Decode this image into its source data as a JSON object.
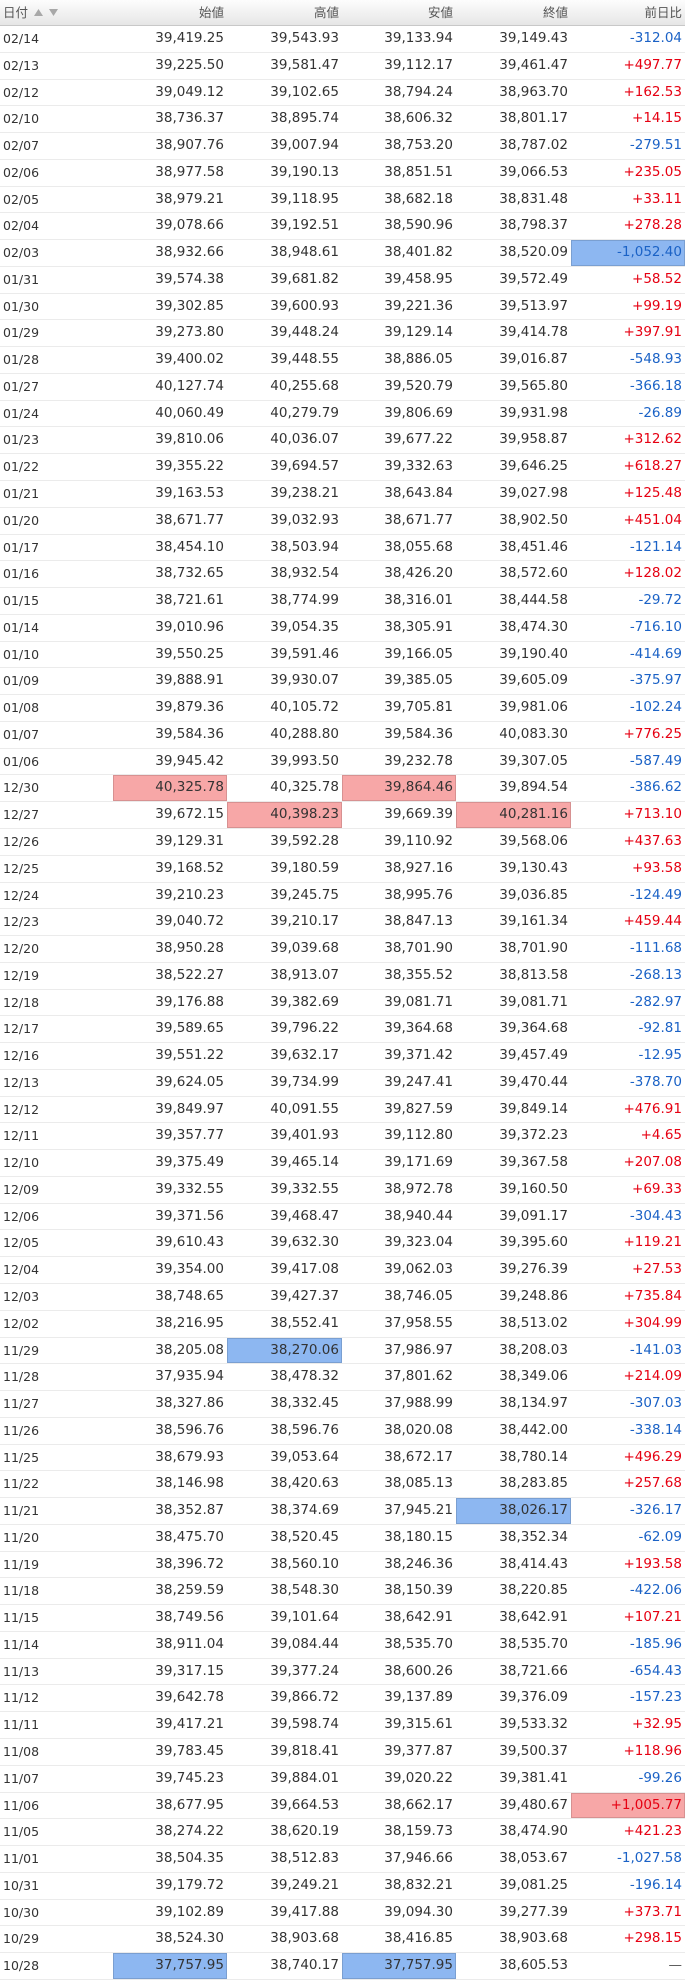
{
  "colors": {
    "up": "#e60012",
    "down": "#1b62c6",
    "flat": "#555555",
    "max_highlight": "#f7a7a7",
    "min_highlight": "#8db7f1",
    "sort_icon": "#a8a8a8"
  },
  "icons": [
    "sort-ascending-icon",
    "sort-descending-icon"
  ],
  "table": {
    "header": {
      "date": "日付",
      "open": "始値",
      "high": "高値",
      "low": "安値",
      "close": "終値",
      "change": "前日比"
    },
    "rows": [
      {
        "date": "02/14",
        "open": "39,419.25",
        "high": "39,543.93",
        "low": "39,133.94",
        "close": "39,149.43",
        "change": "-312.04"
      },
      {
        "date": "02/13",
        "open": "39,225.50",
        "high": "39,581.47",
        "low": "39,112.17",
        "close": "39,461.47",
        "change": "+497.77"
      },
      {
        "date": "02/12",
        "open": "39,049.12",
        "high": "39,102.65",
        "low": "38,794.24",
        "close": "38,963.70",
        "change": "+162.53"
      },
      {
        "date": "02/10",
        "open": "38,736.37",
        "high": "38,895.74",
        "low": "38,606.32",
        "close": "38,801.17",
        "change": "+14.15"
      },
      {
        "date": "02/07",
        "open": "38,907.76",
        "high": "39,007.94",
        "low": "38,753.20",
        "close": "38,787.02",
        "change": "-279.51"
      },
      {
        "date": "02/06",
        "open": "38,977.58",
        "high": "39,190.13",
        "low": "38,851.51",
        "close": "39,066.53",
        "change": "+235.05"
      },
      {
        "date": "02/05",
        "open": "38,979.21",
        "high": "39,118.95",
        "low": "38,682.18",
        "close": "38,831.48",
        "change": "+33.11"
      },
      {
        "date": "02/04",
        "open": "39,078.66",
        "high": "39,192.51",
        "low": "38,590.96",
        "close": "38,798.37",
        "change": "+278.28"
      },
      {
        "date": "02/03",
        "open": "38,932.66",
        "high": "38,948.61",
        "low": "38,401.82",
        "close": "38,520.09",
        "change": "-1,052.40",
        "highlight": {
          "change": "#8db7f1"
        }
      },
      {
        "date": "01/31",
        "open": "39,574.38",
        "high": "39,681.82",
        "low": "39,458.95",
        "close": "39,572.49",
        "change": "+58.52"
      },
      {
        "date": "01/30",
        "open": "39,302.85",
        "high": "39,600.93",
        "low": "39,221.36",
        "close": "39,513.97",
        "change": "+99.19"
      },
      {
        "date": "01/29",
        "open": "39,273.80",
        "high": "39,448.24",
        "low": "39,129.14",
        "close": "39,414.78",
        "change": "+397.91"
      },
      {
        "date": "01/28",
        "open": "39,400.02",
        "high": "39,448.55",
        "low": "38,886.05",
        "close": "39,016.87",
        "change": "-548.93"
      },
      {
        "date": "01/27",
        "open": "40,127.74",
        "high": "40,255.68",
        "low": "39,520.79",
        "close": "39,565.80",
        "change": "-366.18"
      },
      {
        "date": "01/24",
        "open": "40,060.49",
        "high": "40,279.79",
        "low": "39,806.69",
        "close": "39,931.98",
        "change": "-26.89"
      },
      {
        "date": "01/23",
        "open": "39,810.06",
        "high": "40,036.07",
        "low": "39,677.22",
        "close": "39,958.87",
        "change": "+312.62"
      },
      {
        "date": "01/22",
        "open": "39,355.22",
        "high": "39,694.57",
        "low": "39,332.63",
        "close": "39,646.25",
        "change": "+618.27"
      },
      {
        "date": "01/21",
        "open": "39,163.53",
        "high": "39,238.21",
        "low": "38,643.84",
        "close": "39,027.98",
        "change": "+125.48"
      },
      {
        "date": "01/20",
        "open": "38,671.77",
        "high": "39,032.93",
        "low": "38,671.77",
        "close": "38,902.50",
        "change": "+451.04"
      },
      {
        "date": "01/17",
        "open": "38,454.10",
        "high": "38,503.94",
        "low": "38,055.68",
        "close": "38,451.46",
        "change": "-121.14"
      },
      {
        "date": "01/16",
        "open": "38,732.65",
        "high": "38,932.54",
        "low": "38,426.20",
        "close": "38,572.60",
        "change": "+128.02"
      },
      {
        "date": "01/15",
        "open": "38,721.61",
        "high": "38,774.99",
        "low": "38,316.01",
        "close": "38,444.58",
        "change": "-29.72"
      },
      {
        "date": "01/14",
        "open": "39,010.96",
        "high": "39,054.35",
        "low": "38,305.91",
        "close": "38,474.30",
        "change": "-716.10"
      },
      {
        "date": "01/10",
        "open": "39,550.25",
        "high": "39,591.46",
        "low": "39,166.05",
        "close": "39,190.40",
        "change": "-414.69"
      },
      {
        "date": "01/09",
        "open": "39,888.91",
        "high": "39,930.07",
        "low": "39,385.05",
        "close": "39,605.09",
        "change": "-375.97"
      },
      {
        "date": "01/08",
        "open": "39,879.36",
        "high": "40,105.72",
        "low": "39,705.81",
        "close": "39,981.06",
        "change": "-102.24"
      },
      {
        "date": "01/07",
        "open": "39,584.36",
        "high": "40,288.80",
        "low": "39,584.36",
        "close": "40,083.30",
        "change": "+776.25"
      },
      {
        "date": "01/06",
        "open": "39,945.42",
        "high": "39,993.50",
        "low": "39,232.78",
        "close": "39,307.05",
        "change": "-587.49"
      },
      {
        "date": "12/30",
        "open": "40,325.78",
        "high": "40,325.78",
        "low": "39,864.46",
        "close": "39,894.54",
        "change": "-386.62",
        "highlight": {
          "open": "#f7a7a7",
          "low": "#f7a7a7"
        }
      },
      {
        "date": "12/27",
        "open": "39,672.15",
        "high": "40,398.23",
        "low": "39,669.39",
        "close": "40,281.16",
        "change": "+713.10",
        "highlight": {
          "high": "#f7a7a7",
          "close": "#f7a7a7"
        }
      },
      {
        "date": "12/26",
        "open": "39,129.31",
        "high": "39,592.28",
        "low": "39,110.92",
        "close": "39,568.06",
        "change": "+437.63"
      },
      {
        "date": "12/25",
        "open": "39,168.52",
        "high": "39,180.59",
        "low": "38,927.16",
        "close": "39,130.43",
        "change": "+93.58"
      },
      {
        "date": "12/24",
        "open": "39,210.23",
        "high": "39,245.75",
        "low": "38,995.76",
        "close": "39,036.85",
        "change": "-124.49"
      },
      {
        "date": "12/23",
        "open": "39,040.72",
        "high": "39,210.17",
        "low": "38,847.13",
        "close": "39,161.34",
        "change": "+459.44"
      },
      {
        "date": "12/20",
        "open": "38,950.28",
        "high": "39,039.68",
        "low": "38,701.90",
        "close": "38,701.90",
        "change": "-111.68"
      },
      {
        "date": "12/19",
        "open": "38,522.27",
        "high": "38,913.07",
        "low": "38,355.52",
        "close": "38,813.58",
        "change": "-268.13"
      },
      {
        "date": "12/18",
        "open": "39,176.88",
        "high": "39,382.69",
        "low": "39,081.71",
        "close": "39,081.71",
        "change": "-282.97"
      },
      {
        "date": "12/17",
        "open": "39,589.65",
        "high": "39,796.22",
        "low": "39,364.68",
        "close": "39,364.68",
        "change": "-92.81"
      },
      {
        "date": "12/16",
        "open": "39,551.22",
        "high": "39,632.17",
        "low": "39,371.42",
        "close": "39,457.49",
        "change": "-12.95"
      },
      {
        "date": "12/13",
        "open": "39,624.05",
        "high": "39,734.99",
        "low": "39,247.41",
        "close": "39,470.44",
        "change": "-378.70"
      },
      {
        "date": "12/12",
        "open": "39,849.97",
        "high": "40,091.55",
        "low": "39,827.59",
        "close": "39,849.14",
        "change": "+476.91"
      },
      {
        "date": "12/11",
        "open": "39,357.77",
        "high": "39,401.93",
        "low": "39,112.80",
        "close": "39,372.23",
        "change": "+4.65"
      },
      {
        "date": "12/10",
        "open": "39,375.49",
        "high": "39,465.14",
        "low": "39,171.69",
        "close": "39,367.58",
        "change": "+207.08"
      },
      {
        "date": "12/09",
        "open": "39,332.55",
        "high": "39,332.55",
        "low": "38,972.78",
        "close": "39,160.50",
        "change": "+69.33"
      },
      {
        "date": "12/06",
        "open": "39,371.56",
        "high": "39,468.47",
        "low": "38,940.44",
        "close": "39,091.17",
        "change": "-304.43"
      },
      {
        "date": "12/05",
        "open": "39,610.43",
        "high": "39,632.30",
        "low": "39,323.04",
        "close": "39,395.60",
        "change": "+119.21"
      },
      {
        "date": "12/04",
        "open": "39,354.00",
        "high": "39,417.08",
        "low": "39,062.03",
        "close": "39,276.39",
        "change": "+27.53"
      },
      {
        "date": "12/03",
        "open": "38,748.65",
        "high": "39,427.37",
        "low": "38,746.05",
        "close": "39,248.86",
        "change": "+735.84"
      },
      {
        "date": "12/02",
        "open": "38,216.95",
        "high": "38,552.41",
        "low": "37,958.55",
        "close": "38,513.02",
        "change": "+304.99"
      },
      {
        "date": "11/29",
        "open": "38,205.08",
        "high": "38,270.06",
        "low": "37,986.97",
        "close": "38,208.03",
        "change": "-141.03",
        "highlight": {
          "high": "#8db7f1"
        }
      },
      {
        "date": "11/28",
        "open": "37,935.94",
        "high": "38,478.32",
        "low": "37,801.62",
        "close": "38,349.06",
        "change": "+214.09"
      },
      {
        "date": "11/27",
        "open": "38,327.86",
        "high": "38,332.45",
        "low": "37,988.99",
        "close": "38,134.97",
        "change": "-307.03"
      },
      {
        "date": "11/26",
        "open": "38,596.76",
        "high": "38,596.76",
        "low": "38,020.08",
        "close": "38,442.00",
        "change": "-338.14"
      },
      {
        "date": "11/25",
        "open": "38,679.93",
        "high": "39,053.64",
        "low": "38,672.17",
        "close": "38,780.14",
        "change": "+496.29"
      },
      {
        "date": "11/22",
        "open": "38,146.98",
        "high": "38,420.63",
        "low": "38,085.13",
        "close": "38,283.85",
        "change": "+257.68"
      },
      {
        "date": "11/21",
        "open": "38,352.87",
        "high": "38,374.69",
        "low": "37,945.21",
        "close": "38,026.17",
        "change": "-326.17",
        "highlight": {
          "close": "#8db7f1"
        }
      },
      {
        "date": "11/20",
        "open": "38,475.70",
        "high": "38,520.45",
        "low": "38,180.15",
        "close": "38,352.34",
        "change": "-62.09"
      },
      {
        "date": "11/19",
        "open": "38,396.72",
        "high": "38,560.10",
        "low": "38,246.36",
        "close": "38,414.43",
        "change": "+193.58"
      },
      {
        "date": "11/18",
        "open": "38,259.59",
        "high": "38,548.30",
        "low": "38,150.39",
        "close": "38,220.85",
        "change": "-422.06"
      },
      {
        "date": "11/15",
        "open": "38,749.56",
        "high": "39,101.64",
        "low": "38,642.91",
        "close": "38,642.91",
        "change": "+107.21"
      },
      {
        "date": "11/14",
        "open": "38,911.04",
        "high": "39,084.44",
        "low": "38,535.70",
        "close": "38,535.70",
        "change": "-185.96"
      },
      {
        "date": "11/13",
        "open": "39,317.15",
        "high": "39,377.24",
        "low": "38,600.26",
        "close": "38,721.66",
        "change": "-654.43"
      },
      {
        "date": "11/12",
        "open": "39,642.78",
        "high": "39,866.72",
        "low": "39,137.89",
        "close": "39,376.09",
        "change": "-157.23"
      },
      {
        "date": "11/11",
        "open": "39,417.21",
        "high": "39,598.74",
        "low": "39,315.61",
        "close": "39,533.32",
        "change": "+32.95"
      },
      {
        "date": "11/08",
        "open": "39,783.45",
        "high": "39,818.41",
        "low": "39,377.87",
        "close": "39,500.37",
        "change": "+118.96"
      },
      {
        "date": "11/07",
        "open": "39,745.23",
        "high": "39,884.01",
        "low": "39,020.22",
        "close": "39,381.41",
        "change": "-99.26"
      },
      {
        "date": "11/06",
        "open": "38,677.95",
        "high": "39,664.53",
        "low": "38,662.17",
        "close": "39,480.67",
        "change": "+1,005.77",
        "highlight": {
          "change": "#f7a7a7"
        }
      },
      {
        "date": "11/05",
        "open": "38,274.22",
        "high": "38,620.19",
        "low": "38,159.73",
        "close": "38,474.90",
        "change": "+421.23"
      },
      {
        "date": "11/01",
        "open": "38,504.35",
        "high": "38,512.83",
        "low": "37,946.66",
        "close": "38,053.67",
        "change": "-1,027.58"
      },
      {
        "date": "10/31",
        "open": "39,179.72",
        "high": "39,249.21",
        "low": "38,832.21",
        "close": "39,081.25",
        "change": "-196.14"
      },
      {
        "date": "10/30",
        "open": "39,102.89",
        "high": "39,417.88",
        "low": "39,094.30",
        "close": "39,277.39",
        "change": "+373.71"
      },
      {
        "date": "10/29",
        "open": "38,524.30",
        "high": "38,903.68",
        "low": "38,416.85",
        "close": "38,903.68",
        "change": "+298.15"
      },
      {
        "date": "10/28",
        "open": "37,757.95",
        "high": "38,740.17",
        "low": "37,757.95",
        "close": "38,605.53",
        "change": "—",
        "highlight": {
          "open": "#8db7f1",
          "low": "#8db7f1"
        }
      }
    ]
  }
}
